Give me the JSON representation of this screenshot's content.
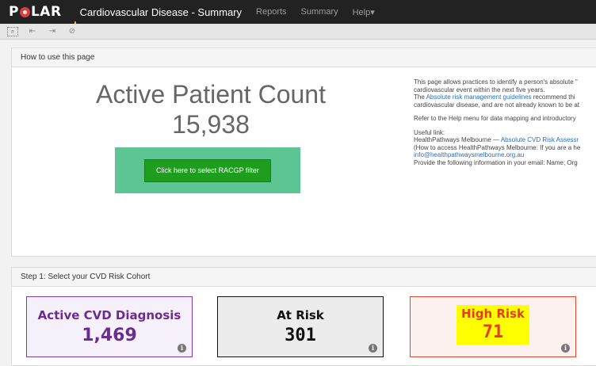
{
  "navbar": {
    "logo": "POLAR",
    "title": "Cardiovascular Disease - Summary",
    "links": [
      "Reports",
      "Summary",
      "Help▾"
    ]
  },
  "toolbar": {
    "icons": [
      "smart-search-icon",
      "back-icon",
      "forward-icon",
      "clear-icon"
    ]
  },
  "how_to": {
    "header": "How to use this page",
    "apc_title": "Active Patient Count",
    "apc_count": "15,938",
    "filter_button": "Click here to select RACGP filter",
    "help": {
      "line1": "This page allows practices to identify a person's absolute \"",
      "line2": "cardiovascular event within the next five years.",
      "line3_pre": "The ",
      "line3_link": "Absolute risk management guidelines",
      "line3_post": " recommend thi",
      "line4": "cardiovascular disease, and are not already known to be at",
      "line5": "Refer to the Help menu for data mapping and introductory",
      "line6": "Useful link:",
      "line7_pre": "HealthPathways Melbourne — ",
      "line7_link": "Absolute CVD Risk Assessr",
      "line8": "(How to access HealthPathways Melbourne: If you are a he",
      "line9_link": "info@healthpathwaysmelbourne.org.au",
      "line10": "Provide the following information in your email: Name; Org"
    }
  },
  "cohort": {
    "header": "Step 1: Select your CVD Risk Cohort",
    "cards": [
      {
        "label": "Active CVD Diagnosis",
        "value": "1,469"
      },
      {
        "label": "At Risk",
        "value": "301"
      },
      {
        "label": "High Risk",
        "value": "71"
      }
    ],
    "info_glyph": "i"
  },
  "colors": {
    "navbar_bg": "#222222",
    "filter_box": "#5cc593",
    "filter_button": "#1f9d1f",
    "cvd_purple": "#6b2c8f",
    "high_risk_red": "#e53d18",
    "high_risk_highlight": "#ffff00"
  }
}
